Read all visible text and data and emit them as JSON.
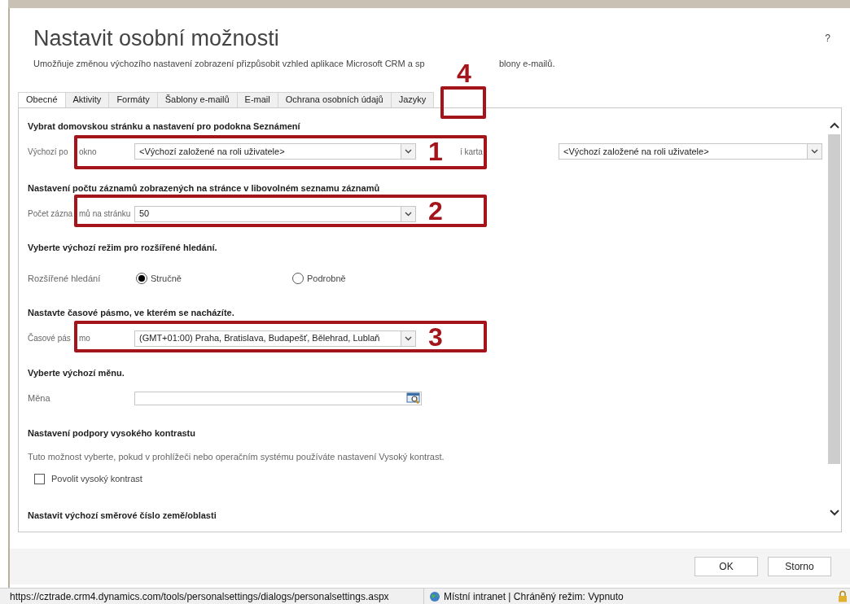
{
  "dialog": {
    "title": "Nastavit osobní možnosti",
    "description_parts": [
      "Umožňuje změnou výchozího nastavení zobrazení přizpůsobit vzhled aplikace Microsoft CRM a sp",
      "blony e-mailů."
    ],
    "help": "?"
  },
  "tabs": [
    {
      "label": "Obecné",
      "selected": true
    },
    {
      "label": "Aktivity",
      "selected": false
    },
    {
      "label": "Formáty",
      "selected": false
    },
    {
      "label": "Šablony e-mailů",
      "selected": false
    },
    {
      "label": "E-mail",
      "selected": false
    },
    {
      "label": "Ochrana osobních údajů",
      "selected": false
    },
    {
      "label": "Jazyky",
      "selected": false
    }
  ],
  "sections": [
    {
      "heading": "Vybrat domovskou stránku a nastavení pro podokna Seznámení",
      "rows": [
        {
          "kind": "dropdown",
          "label_parts": [
            "Výchozí po",
            "okno"
          ],
          "value": "<Výchozí založené na roli uživatele>",
          "side": {
            "label": "í karta",
            "value": "<Výchozí založené na roli uživatele>"
          }
        }
      ]
    },
    {
      "heading": "Nastavení počtu záznamů zobrazených na stránce v libovolném seznamu záznamů",
      "rows": [
        {
          "kind": "dropdown",
          "label_parts": [
            "Počet zázna",
            "mů na stránku"
          ],
          "value": "50"
        }
      ]
    },
    {
      "heading": "Vyberte výchozí režim pro rozšířené hledání.",
      "rows": [
        {
          "kind": "radio",
          "label": "Rozšířené hledání",
          "options": [
            {
              "label": "Stručně",
              "selected": true
            },
            {
              "label": "Podrobně",
              "selected": false
            }
          ]
        }
      ]
    },
    {
      "heading": "Nastavte časové pásmo, ve kterém se nacházíte.",
      "rows": [
        {
          "kind": "dropdown",
          "label_parts": [
            "Časové pás",
            "mo"
          ],
          "value": "(GMT+01:00) Praha, Bratislava, Budapešť, Bělehrad, Lublaň"
        }
      ]
    },
    {
      "heading": "Vyberte výchozí měnu.",
      "rows": [
        {
          "kind": "lookup",
          "label": "Měna"
        }
      ]
    },
    {
      "heading": "Nastavení podpory vysokého kontrastu",
      "rows": [
        {
          "kind": "note",
          "text": "Tuto možnost vyberte, pokud v prohlížeči nebo operačním systému používáte nastavení Vysoký kontrast."
        },
        {
          "kind": "checkbox",
          "label": "Povolit vysoký kontrast",
          "checked": false
        }
      ]
    },
    {
      "heading": "Nastavit výchozí směrové číslo země/oblasti"
    }
  ],
  "annotations": [
    {
      "number": "1"
    },
    {
      "number": "2"
    },
    {
      "number": "3"
    },
    {
      "number": "4"
    }
  ],
  "buttons": [
    "OK",
    "Storno"
  ],
  "status_bar": {
    "url": "https://cztrade.crm4.dynamics.com/tools/personalsettings/dialogs/personalsettings.aspx",
    "zone": "Místní intranet | Chráněný režim: Vypnuto"
  }
}
